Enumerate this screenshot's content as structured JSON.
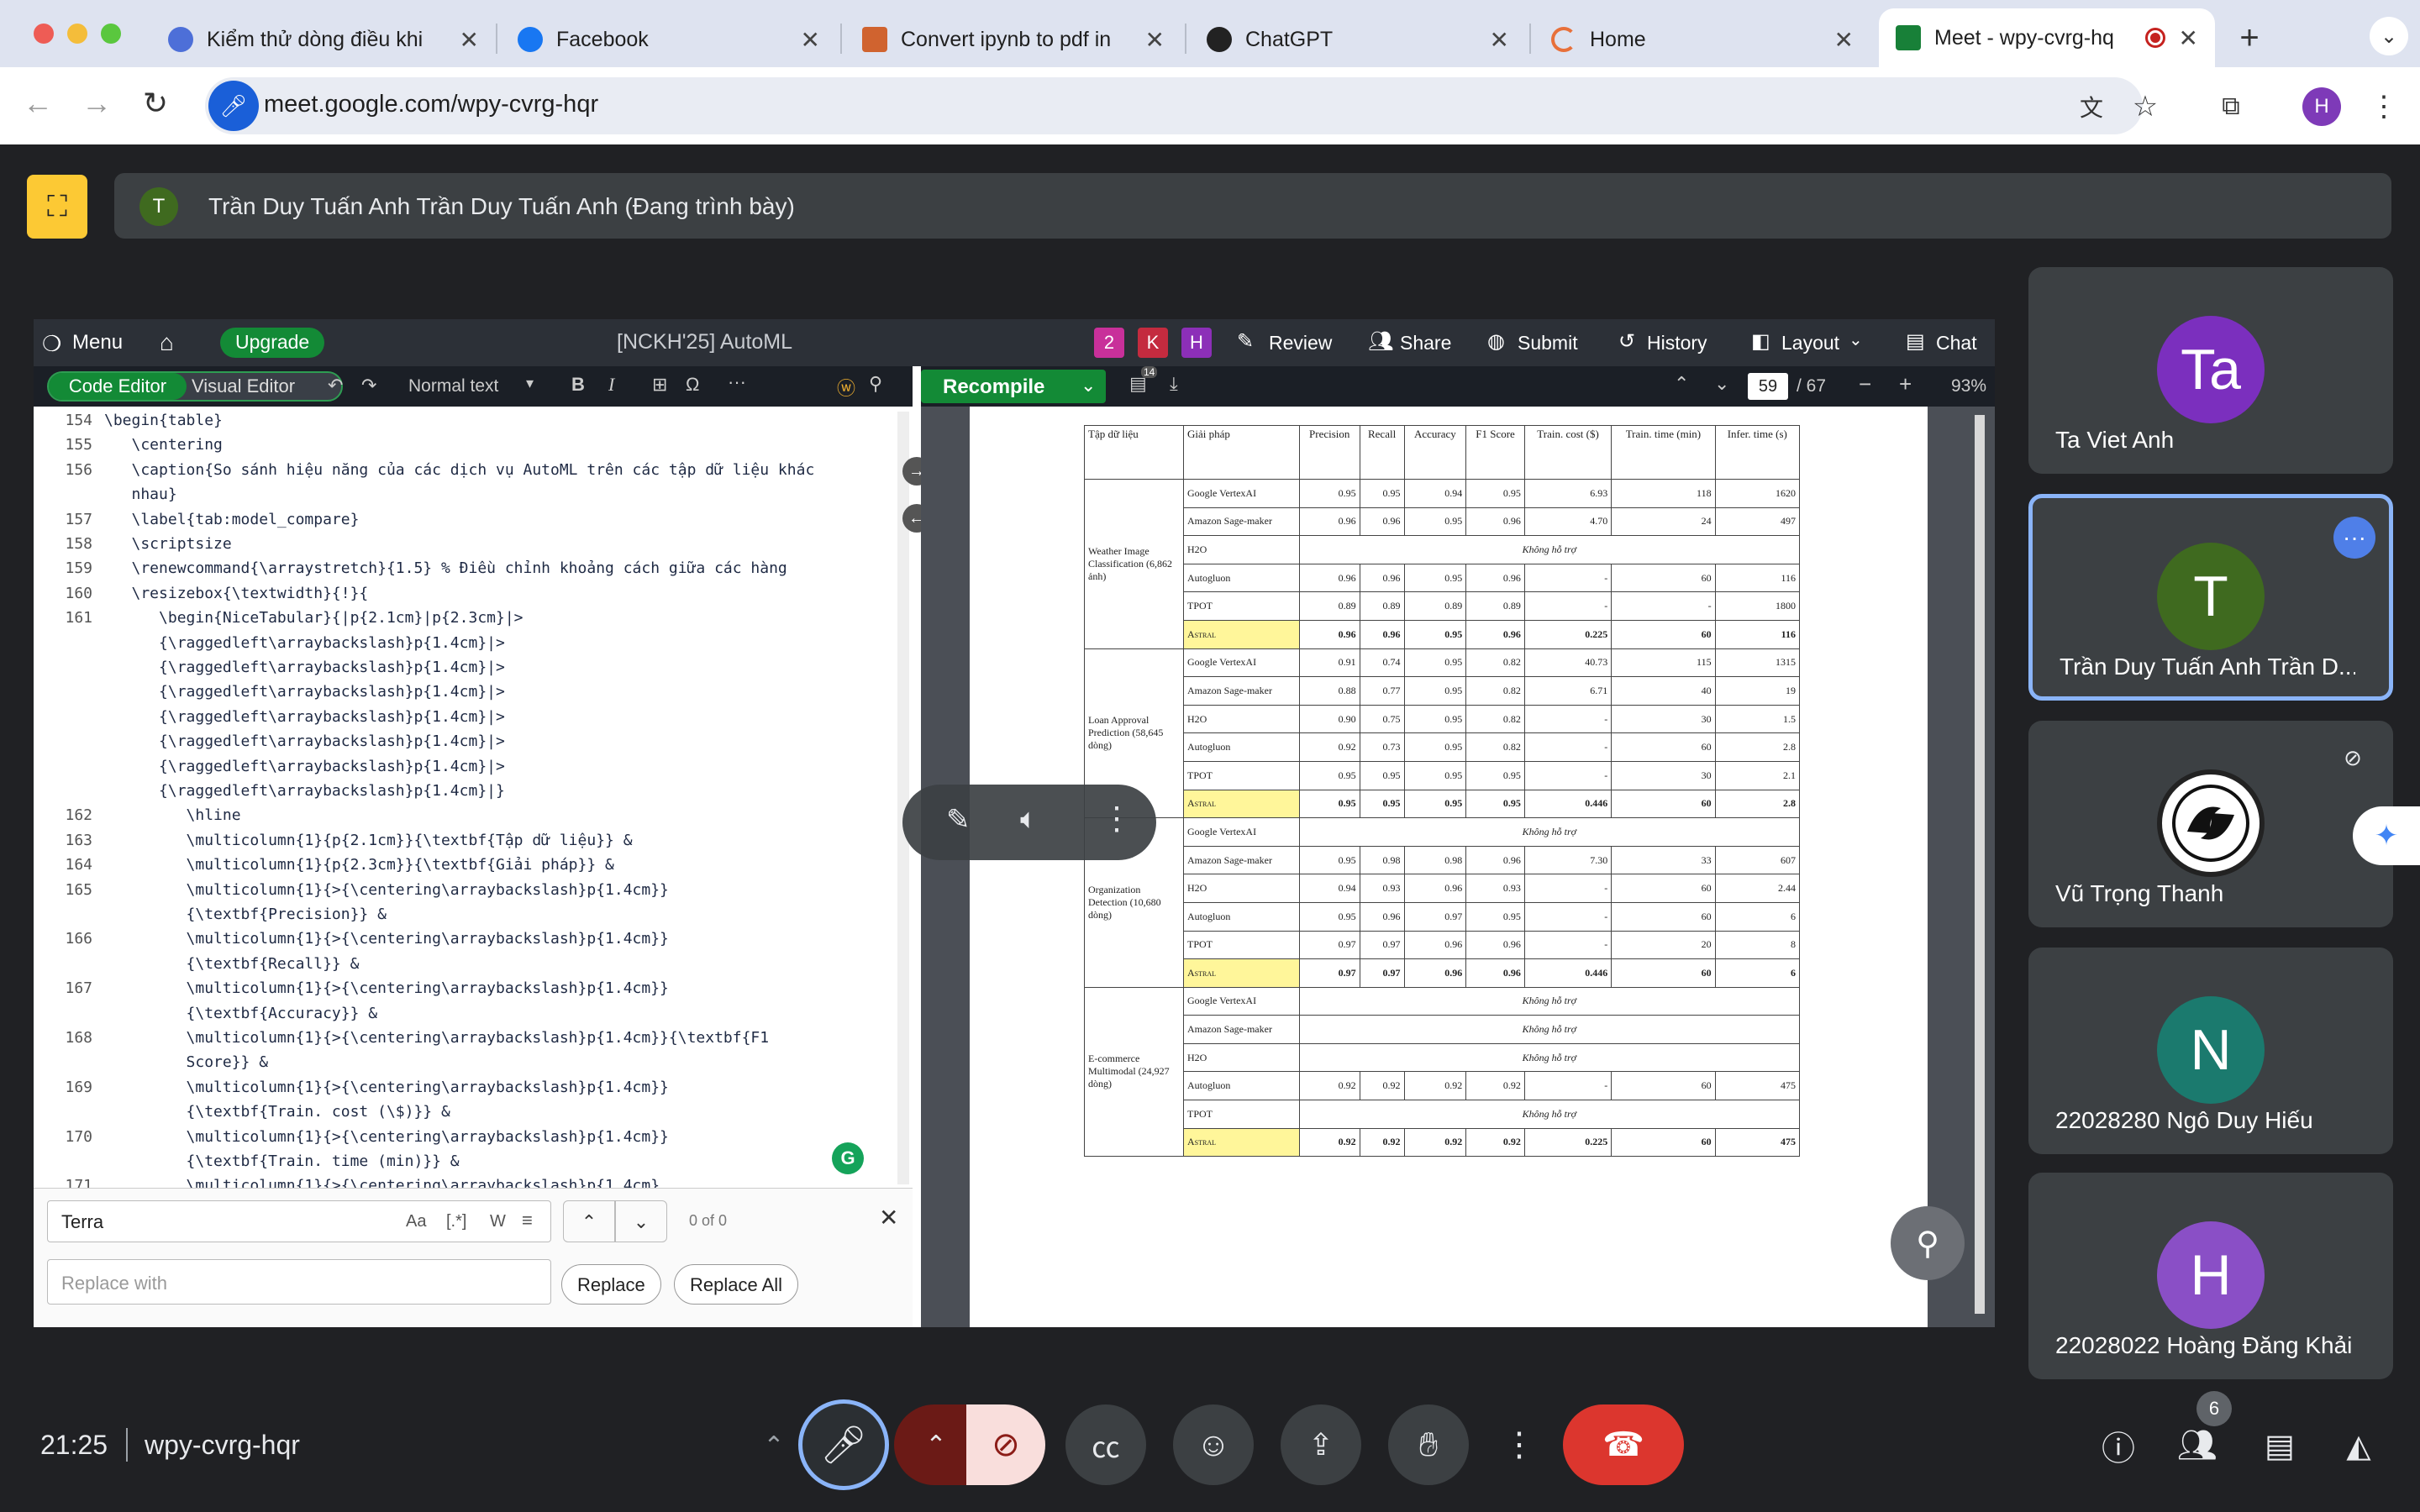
{
  "browser": {
    "tabs": [
      {
        "title": "Kiểm thử dòng điều khi",
        "color": "#4d6fd8"
      },
      {
        "title": "Facebook",
        "color": "#1877f2"
      },
      {
        "title": "Convert ipynb to pdf in",
        "color": "#d0632f"
      },
      {
        "title": "ChatGPT",
        "color": "#222222"
      },
      {
        "title": "Home",
        "color": "#e8703a"
      },
      {
        "title": "Meet - wpy-cvrg-hq",
        "color": "#188038"
      }
    ],
    "url": "meet.google.com/wpy-cvrg-hqr",
    "profile": "H"
  },
  "presenter": {
    "initial": "T",
    "text": "Trần Duy Tuấn Anh Trần Duy Tuấn Anh (Đang trình bày)"
  },
  "overleaf": {
    "menu": "Menu",
    "upgrade": "Upgrade",
    "project": "[NCKH'25] AutoML",
    "collab": [
      "2",
      "K",
      "H"
    ],
    "review": "Review",
    "share": "Share",
    "submit": "Submit",
    "history": "History",
    "layout": "Layout",
    "chat": "Chat",
    "code_editor": "Code Editor",
    "visual_editor": "Visual Editor",
    "normal_text": "Normal text",
    "recompile": "Recompile",
    "log_badge": "14",
    "page_num": "59",
    "page_total": "/ 67",
    "zoom": "93%"
  },
  "code": [
    {
      "n": "154",
      "t": "\\begin{table}"
    },
    {
      "n": "155",
      "t": "   \\centering"
    },
    {
      "n": "156",
      "t": "   \\caption{So sánh hiệu năng của các dịch vụ AutoML trên các tập dữ liệu khác"
    },
    {
      "n": "",
      "t": "   nhau}"
    },
    {
      "n": "157",
      "t": "   \\label{tab:model_compare}"
    },
    {
      "n": "158",
      "t": "   \\scriptsize"
    },
    {
      "n": "159",
      "t": "   \\renewcommand{\\arraystretch}{1.5} % Điều chỉnh khoảng cách giữa các hàng"
    },
    {
      "n": "160",
      "t": "   \\resizebox{\\textwidth}{!}{"
    },
    {
      "n": "161",
      "t": "      \\begin{NiceTabular}{|p{2.1cm}|p{2.3cm}|>"
    },
    {
      "n": "",
      "t": "      {\\raggedleft\\arraybackslash}p{1.4cm}|>"
    },
    {
      "n": "",
      "t": "      {\\raggedleft\\arraybackslash}p{1.4cm}|>"
    },
    {
      "n": "",
      "t": "      {\\raggedleft\\arraybackslash}p{1.4cm}|>"
    },
    {
      "n": "",
      "t": "      {\\raggedleft\\arraybackslash}p{1.4cm}|>"
    },
    {
      "n": "",
      "t": "      {\\raggedleft\\arraybackslash}p{1.4cm}|>"
    },
    {
      "n": "",
      "t": "      {\\raggedleft\\arraybackslash}p{1.4cm}|>"
    },
    {
      "n": "",
      "t": "      {\\raggedleft\\arraybackslash}p{1.4cm}|}"
    },
    {
      "n": "162",
      "t": "         \\hline"
    },
    {
      "n": "163",
      "t": "         \\multicolumn{1}{p{2.1cm}}{\\textbf{Tập dữ liệu}} &"
    },
    {
      "n": "164",
      "t": "         \\multicolumn{1}{p{2.3cm}}{\\textbf{Giải pháp}} &"
    },
    {
      "n": "165",
      "t": "         \\multicolumn{1}{>{\\centering\\arraybackslash}p{1.4cm}}"
    },
    {
      "n": "",
      "t": "         {\\textbf{Precision}} &"
    },
    {
      "n": "166",
      "t": "         \\multicolumn{1}{>{\\centering\\arraybackslash}p{1.4cm}}"
    },
    {
      "n": "",
      "t": "         {\\textbf{Recall}} &"
    },
    {
      "n": "167",
      "t": "         \\multicolumn{1}{>{\\centering\\arraybackslash}p{1.4cm}}"
    },
    {
      "n": "",
      "t": "         {\\textbf{Accuracy}} &"
    },
    {
      "n": "168",
      "t": "         \\multicolumn{1}{>{\\centering\\arraybackslash}p{1.4cm}}{\\textbf{F1"
    },
    {
      "n": "",
      "t": "         Score}} &"
    },
    {
      "n": "169",
      "t": "         \\multicolumn{1}{>{\\centering\\arraybackslash}p{1.4cm}}"
    },
    {
      "n": "",
      "t": "         {\\textbf{Train. cost (\\$)}} &"
    },
    {
      "n": "170",
      "t": "         \\multicolumn{1}{>{\\centering\\arraybackslash}p{1.4cm}}"
    },
    {
      "n": "",
      "t": "         {\\textbf{Train. time (min)}} &"
    },
    {
      "n": "171",
      "t": "         \\multicolumn{1}{>{\\centering\\arraybackslash}p{1.4cm}"
    }
  ],
  "find": {
    "query": "Terra",
    "aa": "Aa",
    "regex": "[.*]",
    "word": "W",
    "count": "0 of 0",
    "replace_placeholder": "Replace with",
    "replace": "Replace",
    "replace_all": "Replace All"
  },
  "table": {
    "headers": [
      "Tập dữ liệu",
      "Giải pháp",
      "Precision",
      "Recall",
      "Accuracy",
      "F1 Score",
      "Train. cost ($)",
      "Train. time (min)",
      "Infer. time (s)"
    ],
    "not_supported": "Không hỗ trợ",
    "groups": [
      {
        "dataset": "Weather Image Classification (6,862 ảnh)",
        "rows": [
          {
            "sol": "Google VertexAI",
            "v": [
              "0.95",
              "0.95",
              "0.94",
              "0.95",
              "6.93",
              "118",
              "1620"
            ]
          },
          {
            "sol": "Amazon Sage-maker",
            "v": [
              "0.96",
              "0.96",
              "0.95",
              "0.96",
              "4.70",
              "24",
              "497"
            ]
          },
          {
            "sol": "H2O",
            "ns": true
          },
          {
            "sol": "Autogluon",
            "v": [
              "0.96",
              "0.96",
              "0.95",
              "0.96",
              "-",
              "60",
              "116"
            ]
          },
          {
            "sol": "TPOT",
            "v": [
              "0.89",
              "0.89",
              "0.89",
              "0.89",
              "-",
              "-",
              "1800"
            ]
          },
          {
            "sol": "Astral",
            "astral": true,
            "v": [
              "0.96",
              "0.96",
              "0.95",
              "0.96",
              "0.225",
              "60",
              "116"
            ]
          }
        ]
      },
      {
        "dataset": "Loan Approval Prediction (58,645 dòng)",
        "rows": [
          {
            "sol": "Google VertexAI",
            "v": [
              "0.91",
              "0.74",
              "0.95",
              "0.82",
              "40.73",
              "115",
              "1315"
            ]
          },
          {
            "sol": "Amazon Sage-maker",
            "v": [
              "0.88",
              "0.77",
              "0.95",
              "0.82",
              "6.71",
              "40",
              "19"
            ]
          },
          {
            "sol": "H2O",
            "v": [
              "0.90",
              "0.75",
              "0.95",
              "0.82",
              "-",
              "30",
              "1.5"
            ]
          },
          {
            "sol": "Autogluon",
            "v": [
              "0.92",
              "0.73",
              "0.95",
              "0.82",
              "-",
              "60",
              "2.8"
            ]
          },
          {
            "sol": "TPOT",
            "v": [
              "0.95",
              "0.95",
              "0.95",
              "0.95",
              "-",
              "30",
              "2.1"
            ]
          },
          {
            "sol": "Astral",
            "astral": true,
            "v": [
              "0.95",
              "0.95",
              "0.95",
              "0.95",
              "0.446",
              "60",
              "2.8"
            ]
          }
        ]
      },
      {
        "dataset": "Organization Detection (10,680 dòng)",
        "rows": [
          {
            "sol": "Google VertexAI",
            "ns": true
          },
          {
            "sol": "Amazon Sage-maker",
            "v": [
              "0.95",
              "0.98",
              "0.98",
              "0.96",
              "7.30",
              "33",
              "607"
            ]
          },
          {
            "sol": "H2O",
            "v": [
              "0.94",
              "0.93",
              "0.96",
              "0.93",
              "-",
              "60",
              "2.44"
            ]
          },
          {
            "sol": "Autogluon",
            "v": [
              "0.95",
              "0.96",
              "0.97",
              "0.95",
              "-",
              "60",
              "6"
            ]
          },
          {
            "sol": "TPOT",
            "v": [
              "0.97",
              "0.97",
              "0.96",
              "0.96",
              "-",
              "20",
              "8"
            ]
          },
          {
            "sol": "Astral",
            "astral": true,
            "v": [
              "0.97",
              "0.97",
              "0.96",
              "0.96",
              "0.446",
              "60",
              "6"
            ]
          }
        ]
      },
      {
        "dataset": "E-commerce Multimodal (24,927 dòng)",
        "rows": [
          {
            "sol": "Google VertexAI",
            "ns": true
          },
          {
            "sol": "Amazon Sage-maker",
            "ns": true
          },
          {
            "sol": "H2O",
            "ns": true
          },
          {
            "sol": "Autogluon",
            "v": [
              "0.92",
              "0.92",
              "0.92",
              "0.92",
              "-",
              "60",
              "475"
            ]
          },
          {
            "sol": "TPOT",
            "ns": true
          },
          {
            "sol": "Astral",
            "astral": true,
            "v": [
              "0.92",
              "0.92",
              "0.92",
              "0.92",
              "0.225",
              "60",
              "475"
            ]
          }
        ]
      }
    ]
  },
  "participants": [
    {
      "initials": "Ta",
      "name": "Ta Viet Anh",
      "color": "#7b2fbe"
    },
    {
      "initials": "T",
      "name": "Trần Duy Tuấn Anh Trần D...",
      "color": "#3f6a1f"
    },
    {
      "initials": "",
      "name": "Vũ Trọng Thanh",
      "color": "#ffffff"
    },
    {
      "initials": "N",
      "name": "22028280 Ngô Duy Hiếu",
      "color": "#1b7a6e"
    },
    {
      "initials": "H",
      "name": "22028022 Hoàng Đăng Khải",
      "color": "#8a4fc6"
    }
  ],
  "bottom": {
    "time": "21:25",
    "meeting_code": "wpy-cvrg-hqr",
    "people_count": "6"
  }
}
